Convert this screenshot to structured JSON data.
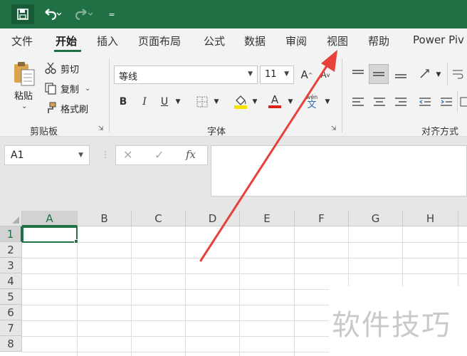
{
  "quick_access": {
    "more": "="
  },
  "tabs": [
    {
      "label": "文件"
    },
    {
      "label": "开始"
    },
    {
      "label": "插入"
    },
    {
      "label": "页面布局"
    },
    {
      "label": "公式"
    },
    {
      "label": "数据"
    },
    {
      "label": "审阅"
    },
    {
      "label": "视图"
    },
    {
      "label": "帮助"
    },
    {
      "label": "Power Piv"
    }
  ],
  "ribbon": {
    "clipboard": {
      "paste_label": "粘贴",
      "cut_label": "剪切",
      "copy_label": "复制",
      "format_painter_label": "格式刷",
      "group_label": "剪贴板"
    },
    "font": {
      "font_name": "等线",
      "font_size": "11",
      "grow_label": "A",
      "shrink_label": "A",
      "bold_label": "B",
      "italic_label": "I",
      "underline_label": "U",
      "font_color_label": "A",
      "phonetic_top": "wén",
      "phonetic_bottom": "文",
      "group_label": "字体"
    },
    "alignment": {
      "group_label": "对齐方式"
    }
  },
  "formula_bar": {
    "name_box": "A1",
    "fx_label": "fx"
  },
  "grid": {
    "columns": [
      "A",
      "B",
      "C",
      "D",
      "E",
      "F",
      "G",
      "H"
    ],
    "rows": [
      "1",
      "2",
      "3",
      "4",
      "5",
      "6",
      "7",
      "8"
    ]
  },
  "watermark": {
    "text": "软件技巧"
  },
  "colors": {
    "excel_green": "#1f7145",
    "annotation_red": "#e8403a"
  }
}
